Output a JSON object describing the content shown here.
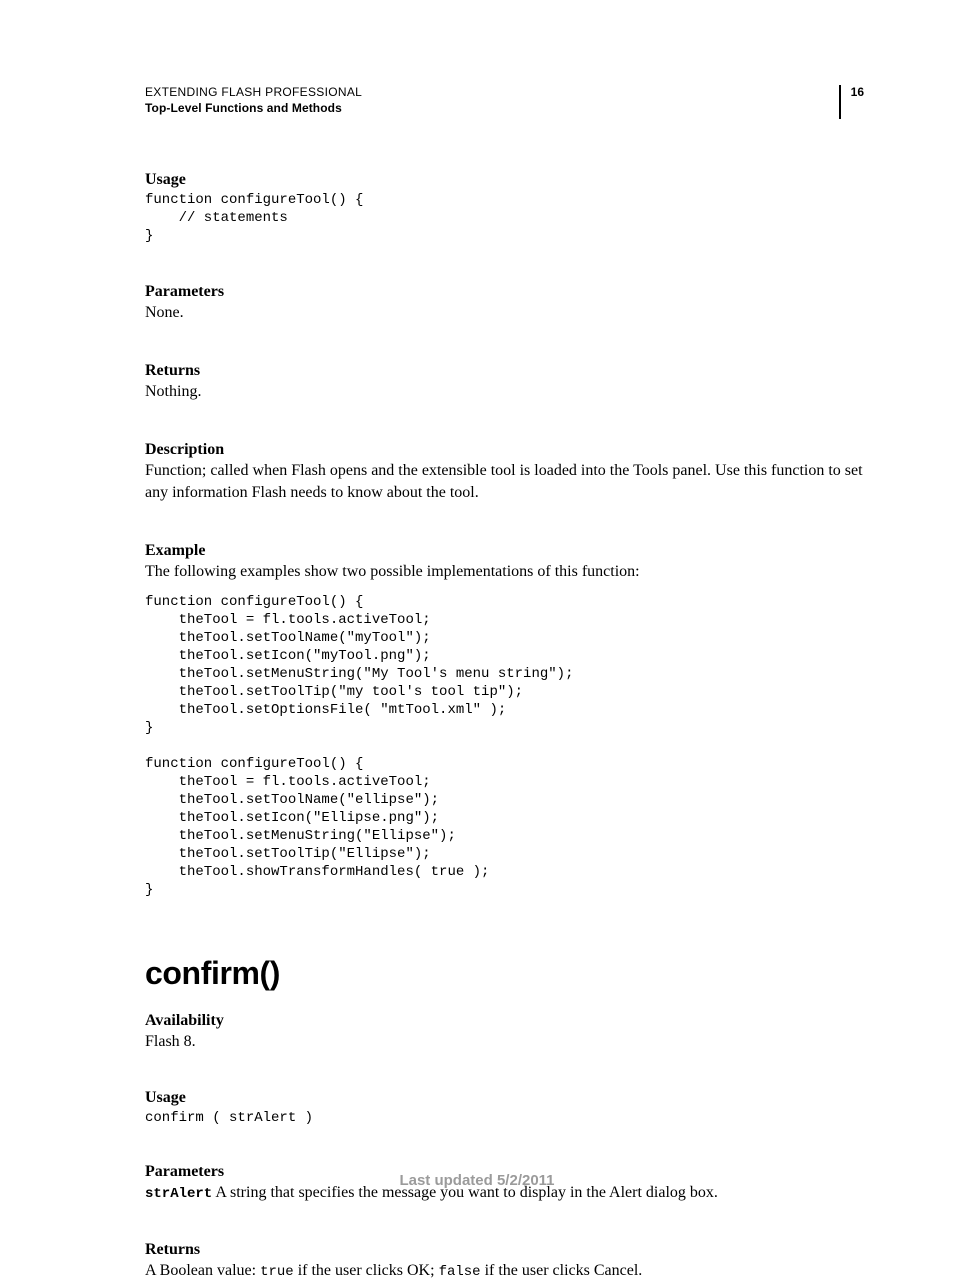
{
  "header": {
    "running": "EXTENDING FLASH PROFESSIONAL",
    "subtitle": "Top-Level Functions and Methods",
    "page": "16"
  },
  "section1": {
    "usage_h": "Usage",
    "usage_code": "function configureTool() {\n    // statements\n}",
    "params_h": "Parameters",
    "params_text": "None.",
    "returns_h": "Returns",
    "returns_text": "Nothing.",
    "desc_h": "Description",
    "desc_text": "Function; called when Flash opens and the extensible tool is loaded into the Tools panel. Use this function to set any information Flash needs to know about the tool.",
    "example_h": "Example",
    "example_intro": "The following examples show two possible implementations of this function:",
    "example_code": "function configureTool() {\n    theTool = fl.tools.activeTool;\n    theTool.setToolName(\"myTool\");\n    theTool.setIcon(\"myTool.png\");\n    theTool.setMenuString(\"My Tool's menu string\");\n    theTool.setToolTip(\"my tool's tool tip\");\n    theTool.setOptionsFile( \"mtTool.xml\" );\n}\n\nfunction configureTool() {\n    theTool = fl.tools.activeTool;\n    theTool.setToolName(\"ellipse\");\n    theTool.setIcon(\"Ellipse.png\");\n    theTool.setMenuString(\"Ellipse\");\n    theTool.setToolTip(\"Ellipse\");\n    theTool.showTransformHandles( true );\n}"
  },
  "section2": {
    "title": "confirm()",
    "avail_h": "Availability",
    "avail_text": "Flash 8.",
    "usage_h": "Usage",
    "usage_code": "confirm ( strAlert )",
    "params_h": "Parameters",
    "param_name": "strAlert",
    "param_text": "  A string that specifies the message you want to display in the Alert dialog box.",
    "returns_h": "Returns",
    "returns_prefix": "A Boolean value: ",
    "returns_true": "true",
    "returns_mid": " if the user clicks OK; ",
    "returns_false": "false",
    "returns_suffix": " if the user clicks Cancel."
  },
  "footer": "Last updated 5/2/2011"
}
